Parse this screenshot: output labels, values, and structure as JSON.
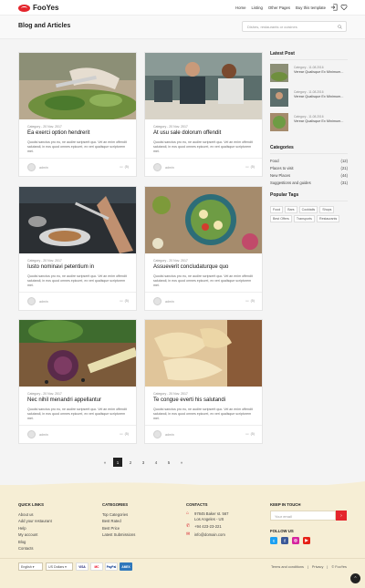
{
  "brand": "FooYes",
  "nav": [
    "Home",
    "Listing",
    "Other Pages",
    "Buy this template"
  ],
  "page_title": "Blog and Articles",
  "search_placeholder": "Dishes, restaurants or cuisines",
  "cards": [
    {
      "meta": "Category - 20 Nov. 2017",
      "title": "Ea exerci option hendrerit",
      "excerpt": "Quodsi sanctus pro eu, ne audire scripserit quo. Vel an enim offendit salutandi, in eos quod omnes epicurei, ex veri qualisque scriptorem mei.",
      "author": "admin",
      "comments": "(5)"
    },
    {
      "meta": "Category - 20 Nov. 2017",
      "title": "At usu sale dolorum offendit",
      "excerpt": "Quodsi sanctus pro eu, ne audire scripserit quo. Vel an enim offendit salutandi, in eos quod omnes epicurei, ex veri qualisque scriptorem mei.",
      "author": "admin",
      "comments": "(5)"
    },
    {
      "meta": "Category - 20 Nov. 2017",
      "title": "Iusto nominavi petentium in",
      "excerpt": "Quodsi sanctus pro eu, ne audire scripserit quo. Vel an enim offendit salutandi, in eos quod omnes epicurei, ex veri qualisque scriptorem mei.",
      "author": "admin",
      "comments": "(5)"
    },
    {
      "meta": "Category - 20 Nov. 2017",
      "title": "Assueverit concludaturque quo",
      "excerpt": "Quodsi sanctus pro eu, ne audire scripserit quo. Vel an enim offendit salutandi, in eos quod omnes epicurei, ex veri qualisque scriptorem mei.",
      "author": "admin",
      "comments": "(5)"
    },
    {
      "meta": "Category - 20 Nov. 2017",
      "title": "Nec nihil menandri appellantur",
      "excerpt": "Quodsi sanctus pro eu, ne audire scripserit quo. Vel an enim offendit salutandi, in eos quod omnes epicurei, ex veri qualisque scriptorem mei.",
      "author": "admin",
      "comments": "(5)"
    },
    {
      "meta": "Category - 20 Nov. 2017",
      "title": "Te congue everti his salutandi",
      "excerpt": "Quodsi sanctus pro eu, ne audire scripserit quo. Vel an enim offendit salutandi, in eos quod omnes epicurei, ex veri qualisque scriptorem mei.",
      "author": "admin",
      "comments": "(5)"
    }
  ],
  "sidebar": {
    "latest_heading": "Latest Post",
    "latest": [
      {
        "meta": "Category - 11.08.2016",
        "title": "Verear Qualisque Ex Minimum..."
      },
      {
        "meta": "Category - 11.08.2016",
        "title": "Verear Qualisque Ex Minimum..."
      },
      {
        "meta": "Category - 11.08.2016",
        "title": "Verear Qualisque Ex Minimum..."
      }
    ],
    "categories_heading": "Categories",
    "categories": [
      {
        "name": "Food",
        "count": "(12)"
      },
      {
        "name": "Places to visit",
        "count": "(21)"
      },
      {
        "name": "New Places",
        "count": "(44)"
      },
      {
        "name": "Suggestions and guides",
        "count": "(31)"
      }
    ],
    "tags_heading": "Popular Tags",
    "tags": [
      "Food",
      "Bars",
      "Cocktails",
      "Shops",
      "Best Offers",
      "Transports",
      "Restaurants"
    ]
  },
  "pagination": [
    "«",
    "1",
    "2",
    "3",
    "4",
    "5",
    "»"
  ],
  "pagination_active": "1",
  "footer": {
    "quick_heading": "QUICK LINKS",
    "quick": [
      "About us",
      "Add your restaurant",
      "Help",
      "My account",
      "Blog",
      "Contacts"
    ],
    "cat_heading": "CATEGORIES",
    "cats": [
      "Top Categories",
      "Best Rated",
      "Best Price",
      "Latest Submissions"
    ],
    "contacts_heading": "CONTACTS",
    "address_1": "97845 Baker st. 567",
    "address_2": "Los Angeles - US",
    "phone": "+94 423-23-221",
    "email": "info@domain.com",
    "touch_heading": "KEEP IN TOUCH",
    "email_placeholder": "Your email",
    "follow_heading": "FOLLOW US",
    "language": "English",
    "currency": "US Dollars",
    "payments": [
      "VISA",
      "MC",
      "PayPal",
      "AMEX"
    ],
    "legal": [
      "Terms and conditions",
      "|",
      "Privacy",
      "|",
      "© FooYes"
    ]
  },
  "colors": {
    "brand": "#e4252c",
    "footer_bg": "#f6eed5",
    "dark": "#222222"
  }
}
